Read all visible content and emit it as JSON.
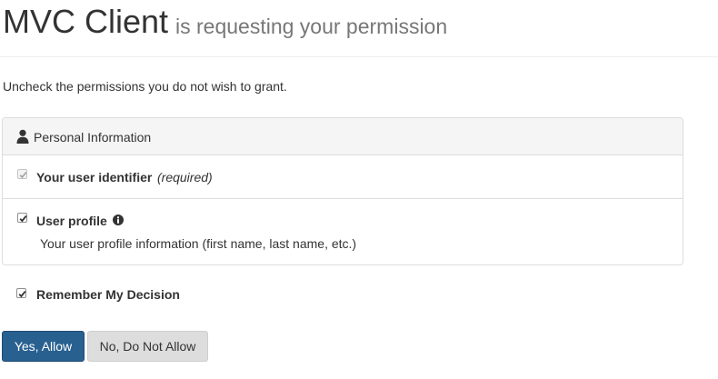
{
  "header": {
    "client_name": "MVC Client",
    "subtitle": "is requesting your permission"
  },
  "instructions": "Uncheck the permissions you do not wish to grant.",
  "panel": {
    "heading": "Personal Information",
    "heading_icon": "user-icon",
    "scopes": [
      {
        "name": "Your user identifier",
        "required_label": "(required)",
        "checked": true,
        "disabled": true
      },
      {
        "name": "User profile",
        "info_icon": "info-circle-icon",
        "description": "Your user profile information (first name, last name, etc.)",
        "checked": true,
        "disabled": false
      }
    ]
  },
  "remember": {
    "label": "Remember My Decision",
    "checked": true
  },
  "buttons": {
    "allow": "Yes, Allow",
    "deny": "No, Do Not Allow"
  },
  "colors": {
    "primary": "#286090",
    "primary_border": "#204d74",
    "default_button": "#dddddd",
    "panel_heading": "#f5f5f5",
    "border": "#dddddd",
    "subtitle": "#777777"
  }
}
